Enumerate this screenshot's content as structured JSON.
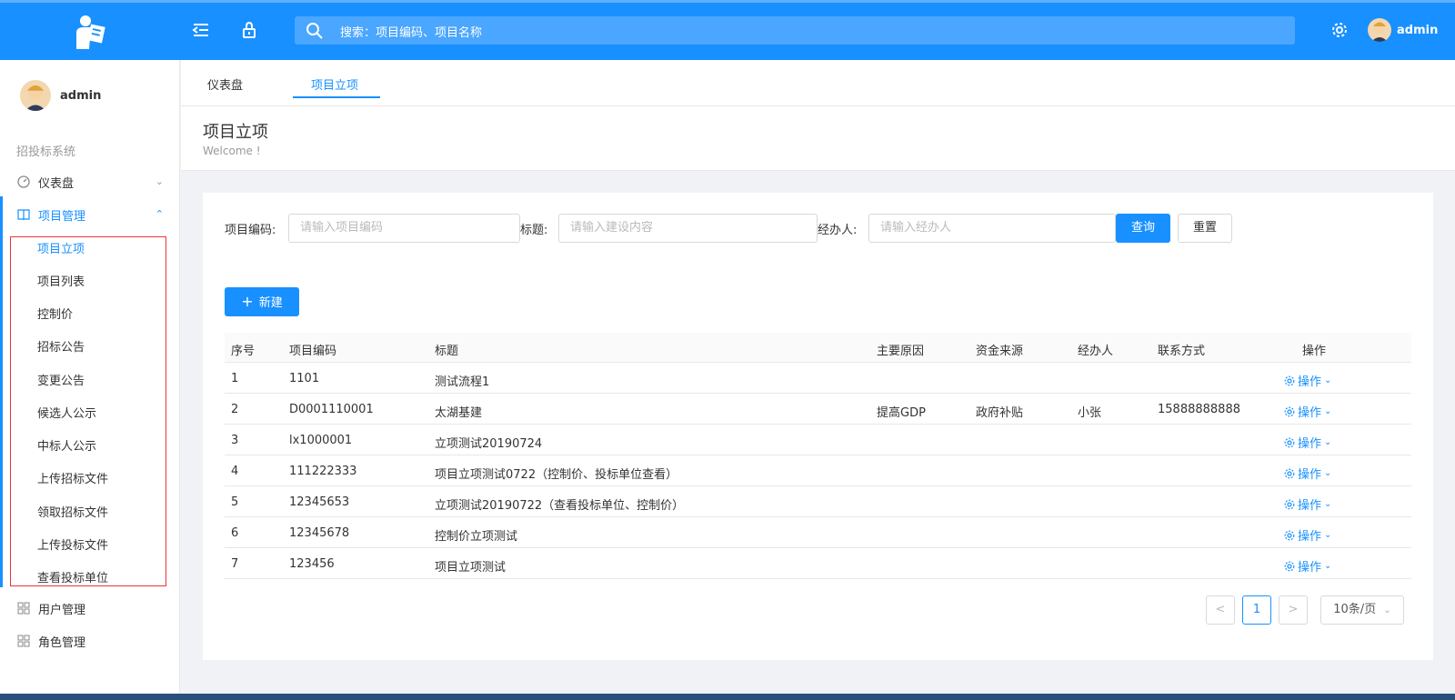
{
  "header": {
    "search_placeholder": "搜索：项目编码、项目名称",
    "username": "admin"
  },
  "sidebar": {
    "username": "admin",
    "category": "招投标系统",
    "menu": [
      {
        "label": "仪表盘",
        "arrow": "⌄"
      },
      {
        "label": "项目管理",
        "arrow": "⌃"
      },
      {
        "label": "用户管理"
      },
      {
        "label": "角色管理"
      }
    ],
    "submenu": [
      "项目立项",
      "项目列表",
      "控制价",
      "招标公告",
      "变更公告",
      "候选人公示",
      "中标人公示",
      "上传招标文件",
      "领取招标文件",
      "上传投标文件",
      "查看投标单位"
    ]
  },
  "tabs": [
    "仪表盘",
    "项目立项"
  ],
  "page": {
    "title": "项目立项",
    "subtitle": "Welcome !"
  },
  "filters": {
    "code_label": "项目编码:",
    "code_placeholder": "请输入项目编码",
    "title_label": "标题:",
    "title_placeholder": "请输入建设内容",
    "handler_label": "经办人:",
    "handler_placeholder": "请输入经办人",
    "query": "查询",
    "reset": "重置"
  },
  "new_button": "新建",
  "table": {
    "headers": [
      "序号",
      "项目编码",
      "标题",
      "主要原因",
      "资金来源",
      "经办人",
      "联系方式",
      "操作"
    ],
    "rows": [
      [
        "1",
        "1101",
        "测试流程1",
        "",
        "",
        "",
        "",
        "操作"
      ],
      [
        "2",
        "D0001110001",
        "太湖基建",
        "提高GDP",
        "政府补贴",
        "小张",
        "15888888888",
        "操作"
      ],
      [
        "3",
        "lx1000001",
        "立项测试20190724",
        "",
        "",
        "",
        "",
        "操作"
      ],
      [
        "4",
        "111222333",
        "项目立项测试0722（控制价、投标单位查看）",
        "",
        "",
        "",
        "",
        "操作"
      ],
      [
        "5",
        "12345653",
        "立项测试20190722（查看投标单位、控制价）",
        "",
        "",
        "",
        "",
        "操作"
      ],
      [
        "6",
        "12345678",
        "控制价立项测试",
        "",
        "",
        "",
        "",
        "操作"
      ],
      [
        "7",
        "123456",
        "项目立项测试",
        "",
        "",
        "",
        "",
        "操作"
      ]
    ]
  },
  "pagination": {
    "prev": "<",
    "current": "1",
    "next": ">",
    "page_size": "10条/页"
  },
  "colors": {
    "primary": "#1890ff",
    "highlight_box": "#e8363a"
  }
}
